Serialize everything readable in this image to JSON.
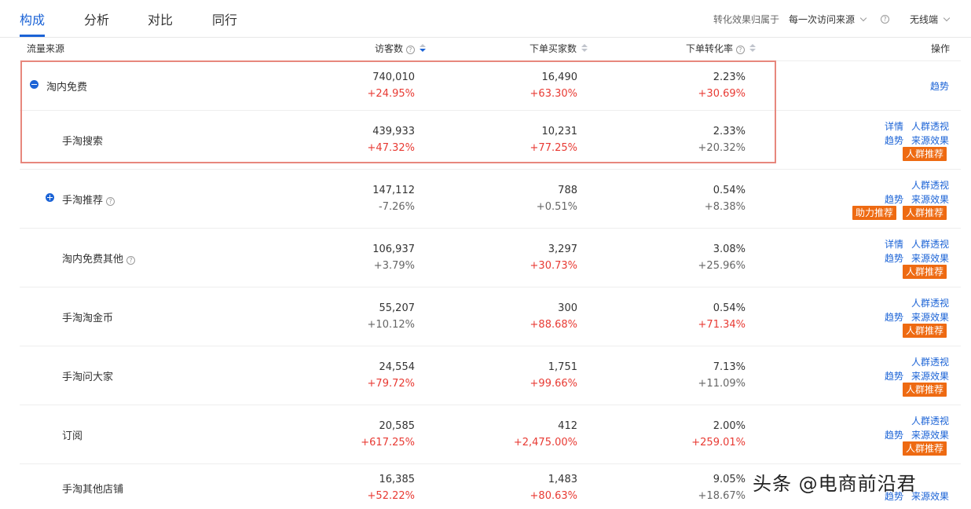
{
  "tabs": [
    {
      "label": "构成",
      "active": true
    },
    {
      "label": "分析",
      "active": false
    },
    {
      "label": "对比",
      "active": false
    },
    {
      "label": "同行",
      "active": false
    }
  ],
  "attribution": {
    "label": "转化效果归属于",
    "value": "每一次访问来源",
    "help": "?",
    "device": "无线端"
  },
  "header": {
    "source": "流量来源",
    "visitors": "访客数",
    "buyers": "下单买家数",
    "rate": "下单转化率",
    "ops": "操作",
    "help": "?"
  },
  "rows": [
    {
      "name": "淘内免费",
      "visitors": "740,010",
      "visitors_change": "+24.95%",
      "buyers": "16,490",
      "buyers_change": "+63.30%",
      "rate": "2.23%",
      "rate_change": "+30.69%",
      "help": "",
      "actions": {
        "trend": "趋势"
      }
    },
    {
      "name": "手淘搜索",
      "visitors": "439,933",
      "visitors_change": "+47.32%",
      "buyers": "10,231",
      "buyers_change": "+77.25%",
      "rate": "2.33%",
      "rate_change": "+20.32%",
      "help": "",
      "actions": {
        "detail": "详情",
        "crowd": "人群透视",
        "trend": "趋势",
        "effect": "来源效果",
        "recommend": "人群推荐"
      }
    },
    {
      "name": "手淘推荐",
      "visitors": "147,112",
      "visitors_change": "-7.26%",
      "buyers": "788",
      "buyers_change": "+0.51%",
      "rate": "0.54%",
      "rate_change": "+8.38%",
      "help": "?",
      "actions": {
        "crowd": "人群透视",
        "trend": "趋势",
        "effect": "来源效果",
        "boost": "助力推荐",
        "recommend": "人群推荐"
      }
    },
    {
      "name": "淘内免费其他",
      "visitors": "106,937",
      "visitors_change": "+3.79%",
      "buyers": "3,297",
      "buyers_change": "+30.73%",
      "rate": "3.08%",
      "rate_change": "+25.96%",
      "help": "?",
      "actions": {
        "detail": "详情",
        "crowd": "人群透视",
        "trend": "趋势",
        "effect": "来源效果",
        "recommend": "人群推荐"
      }
    },
    {
      "name": "手淘淘金币",
      "visitors": "55,207",
      "visitors_change": "+10.12%",
      "buyers": "300",
      "buyers_change": "+88.68%",
      "rate": "0.54%",
      "rate_change": "+71.34%",
      "help": "",
      "actions": {
        "crowd": "人群透视",
        "trend": "趋势",
        "effect": "来源效果",
        "recommend": "人群推荐"
      }
    },
    {
      "name": "手淘问大家",
      "visitors": "24,554",
      "visitors_change": "+79.72%",
      "buyers": "1,751",
      "buyers_change": "+99.66%",
      "rate": "7.13%",
      "rate_change": "+11.09%",
      "help": "",
      "actions": {
        "crowd": "人群透视",
        "trend": "趋势",
        "effect": "来源效果",
        "recommend": "人群推荐"
      }
    },
    {
      "name": "订阅",
      "visitors": "20,585",
      "visitors_change": "+617.25%",
      "buyers": "412",
      "buyers_change": "+2,475.00%",
      "rate": "2.00%",
      "rate_change": "+259.01%",
      "help": "",
      "actions": {
        "crowd": "人群透视",
        "trend": "趋势",
        "effect": "来源效果",
        "recommend": "人群推荐"
      }
    },
    {
      "name": "手淘其他店铺",
      "visitors": "16,385",
      "visitors_change": "+52.22%",
      "buyers": "1,483",
      "buyers_change": "+80.63%",
      "rate": "9.05%",
      "rate_change": "+18.67%",
      "help": "",
      "actions": {
        "trend": "趋势",
        "effect": "来源效果"
      }
    }
  ],
  "watermark": "头条 @电商前沿君",
  "colors": {
    "accent": "#1b63d6",
    "up": "#e83a33",
    "badge": "#ee6a12",
    "highlight": "#e7877d"
  }
}
